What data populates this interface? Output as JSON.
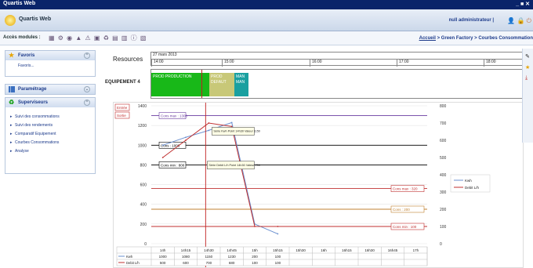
{
  "window": {
    "title": "Quartis Web",
    "controls": "_ ■ ✕"
  },
  "app": {
    "title": "Quartis Web",
    "user": "null administrateur |"
  },
  "toolbar": {
    "modules_label": "Accès modules :",
    "breadcrumb_link": "Accueil",
    "breadcrumb_rest": " > Green Factory > Courbes Consommation"
  },
  "sidebar": {
    "favoris": {
      "title": "Favoris",
      "items": [
        "Favoris..."
      ]
    },
    "parametrage": {
      "title": "Paramétrage"
    },
    "superviseurs": {
      "title": "Superviseurs",
      "items": [
        "Suivi des consommations",
        "Suivi des rendements",
        "Comparatif Equipement",
        "Courbes Consommations",
        "Analyse"
      ]
    }
  },
  "timeline": {
    "resources_label": "Resources",
    "date": "27 mars 2013",
    "ticks": [
      "14:00",
      "15:00",
      "16:00",
      "17:00",
      "18:00"
    ],
    "equipment": "EQUIPEMENT 4",
    "bars": [
      {
        "label": "PROD PRODUCTION",
        "color": "#18b818"
      },
      {
        "label": "PROD DEFAUT",
        "color": "#c8c878"
      },
      {
        "label": "MAN MAN",
        "color": "#1aa0a0"
      }
    ]
  },
  "colors": {
    "kwh": "#6a8fcf",
    "debit": "#c03030",
    "mark": "#c02020"
  },
  "chart_data": {
    "type": "line",
    "categories": [
      "14h",
      "14h15",
      "14h30",
      "14h45",
      "15h",
      "15h15",
      "15h30",
      "16h",
      "16h15",
      "16h30",
      "16h45",
      "17h"
    ],
    "series": [
      {
        "name": "Kwh",
        "values": [
          1000,
          1080,
          1150,
          1230,
          200,
          100,
          null,
          null,
          null,
          null,
          null,
          null
        ],
        "axis": "left",
        "color": "#6a8fcf"
      },
      {
        "name": "Debit L/h",
        "values": [
          500,
          600,
          700,
          680,
          100,
          100,
          null,
          null,
          null,
          null,
          null,
          null
        ],
        "axis": "right",
        "color": "#c03030"
      }
    ],
    "left_axis": {
      "ticks": [
        0,
        200,
        400,
        600,
        800,
        1000,
        1200,
        1400
      ]
    },
    "right_axis": {
      "ticks": [
        0,
        100,
        200,
        300,
        400,
        500,
        600,
        700,
        800
      ]
    },
    "left_lines": [
      {
        "label": "Cons max : 1300",
        "value": 1300,
        "color": "#6a3ca0"
      },
      {
        "label": "Cons : 1000",
        "value": 1000,
        "color": "#000000"
      },
      {
        "label": "Cons min : 800",
        "value": 800,
        "color": "#000000"
      }
    ],
    "right_lines": [
      {
        "label": "Cons max : 320",
        "value": 320,
        "color": "#c03030"
      },
      {
        "label": "Cons : 200",
        "value": 200,
        "color": "#c08030"
      },
      {
        "label": "Cons min : 100",
        "value": 100,
        "color": "#c03030"
      }
    ],
    "boxes": [
      "Entrée",
      "Sortie"
    ],
    "annotations": [
      {
        "text": "Série Kwh Point 14h30 Valeur 1150"
      },
      {
        "text": "Série Debit L/h Point 14h30 Valeur 700"
      }
    ],
    "legend": [
      "Kwh",
      "Debit L/h"
    ],
    "table_rows": [
      {
        "label": "Kwh",
        "values": [
          "1000",
          "1080",
          "1150",
          "1230",
          "200",
          "100",
          "",
          "",
          "",
          "",
          "",
          ""
        ]
      },
      {
        "label": "Debit L/h",
        "values": [
          "500",
          "600",
          "700",
          "680",
          "100",
          "100",
          "",
          "",
          "",
          "",
          "",
          ""
        ]
      }
    ]
  }
}
